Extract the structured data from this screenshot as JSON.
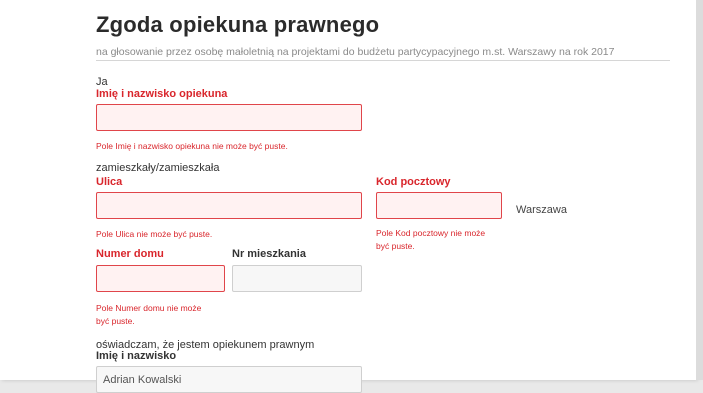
{
  "header": {
    "title": "Zgoda opiekuna prawnego",
    "subtitle": "na głosowanie przez osobę małoletnią na projektami do budżetu partycypacyjnego m.st. Warszawy na rok 2017"
  },
  "form": {
    "intro_ja": "Ja",
    "guardian_name": {
      "label": "Imię i nazwisko opiekuna",
      "value": "",
      "error": "Pole Imię i nazwisko opiekuna nie może być puste."
    },
    "residence_label": "zamieszkały/zamieszkała",
    "street": {
      "label": "Ulica",
      "value": "",
      "error": "Pole Ulica nie może być puste."
    },
    "postal_code": {
      "label": "Kod pocztowy",
      "value": "",
      "error_line1": "Pole Kod pocztowy nie może",
      "error_line2": "być puste."
    },
    "city": "Warszawa",
    "house_number": {
      "label": "Numer domu",
      "value": "",
      "error_line1": "Pole Numer domu nie może",
      "error_line2": "być puste."
    },
    "apartment_number": {
      "label": "Nr mieszkania",
      "value": ""
    },
    "declaration": "oświadczam, że jestem opiekunem prawnym",
    "minor_name": {
      "label": "Imię i nazwisko",
      "value": "Adrian Kowalski"
    }
  },
  "colors": {
    "error": "#d9262c",
    "error_border": "#e0454a",
    "error_fill": "#fff2f2"
  }
}
